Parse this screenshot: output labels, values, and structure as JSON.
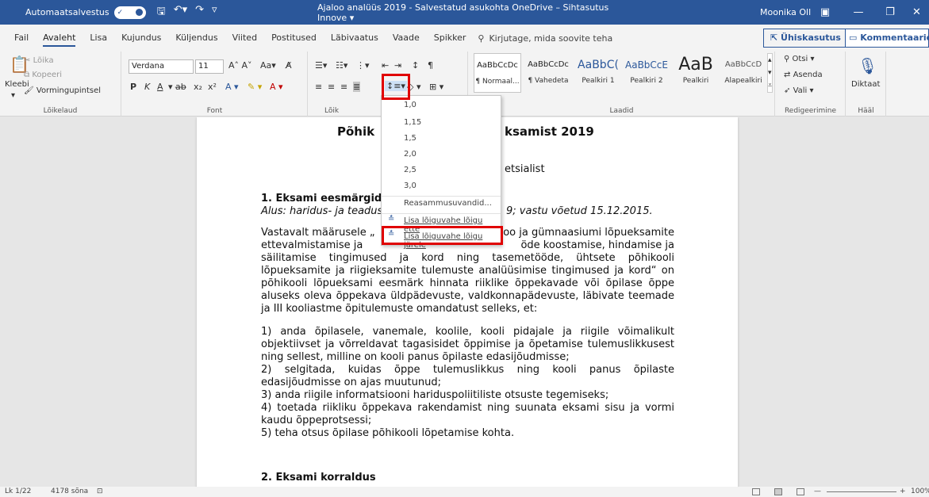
{
  "titlebar": {
    "autosave": "Automaatsalvestus",
    "autosave_state": "✓",
    "title": "Ajaloo analüüs 2019 - Salvestatud asukohta OneDrive – Sihtasutus Innove ▾",
    "user": "Moonika Oll",
    "min": "—",
    "max": "❐",
    "close": "✕"
  },
  "tabs": {
    "items": [
      "Fail",
      "Avaleht",
      "Lisa",
      "Kujundus",
      "Küljendus",
      "Viited",
      "Postitused",
      "Läbivaatus",
      "Vaade",
      "Spikker"
    ],
    "tellme": "Kirjutage, mida soovite teha",
    "share": "Ühiskasutus",
    "comments": "Kommentaarid"
  },
  "ribbon": {
    "clipboard": {
      "paste": "Kleebi",
      "cut": "Lõika",
      "copy": "Kopeeri",
      "painter": "Vormingupintsel",
      "label": "Lõikelaud"
    },
    "font": {
      "name": "Verdana",
      "size": "11",
      "label": "Font",
      "bold": "P",
      "italic": "K",
      "underline": "A"
    },
    "paragraph_label": "Lõik",
    "styles": {
      "label": "Laadid",
      "items": [
        {
          "sample": "AaBbCcDc",
          "name": "¶ Normaal..."
        },
        {
          "sample": "AaBbCcDc",
          "name": "¶ Vahedeta"
        },
        {
          "sample": "AaBbC(",
          "name": "Pealkiri 1"
        },
        {
          "sample": "AaBbCcE",
          "name": "Pealkiri 2"
        },
        {
          "sample": "AaB",
          "name": "Pealkiri"
        },
        {
          "sample": "AaBbCcD",
          "name": "Alapealkiri"
        }
      ]
    },
    "editing": {
      "find": "Otsi",
      "replace": "Asenda",
      "select": "Vali",
      "label": "Redigeerimine"
    },
    "voice": {
      "dictate": "Diktaat",
      "label": "Hääl"
    }
  },
  "dropdown": {
    "options": [
      "1,0",
      "1,15",
      "1,5",
      "2,0",
      "2,5",
      "3,0"
    ],
    "more": "Reasammusuvandid...",
    "add_before": "Lisa lõiguvahe lõigu ette",
    "add_after": "Lisa lõiguvahe lõigu järele"
  },
  "document": {
    "title_left": "Põhik",
    "title_right": "ksamist 2019",
    "subtitle_frag": "etsialist",
    "h1": "1. Eksami eesmärgid",
    "alus_left": "Alus: haridus- ja teadus",
    "alus_right": "9; vastu võetud 15.12.2015.",
    "para1": [
      {
        "l": "Vastavalt määrusele „",
        "r": "oo ja gümnaasiumi lõpueksamite"
      },
      {
        "l": "ettevalmistamise ja",
        "r": "öde koostamise, hindamise ja"
      }
    ],
    "para1_rest": "säilitamise tingimused ja kord ning tasemetööde, ühtsete põhikooli lõpueksamite ja riigieksamite tulemuste analüüsimise tingimused ja kord“ on põhikooli lõpueksami eesmärk hinnata riiklike õppekavade või õpilase õppe aluseks oleva õppekava üldpädevuste, valdkonnapädevuste, läbivate teemade ja III kooliastme õpitulemuste omandatust selleks, et:",
    "list": "1) anda õpilasele, vanemale, koolile, kooli pidajale ja riigile võimalikult objektiivset ja võrreldavat tagasisidet õppimise ja õpetamise tulemuslikkusest ning sellest, milline on kooli panus õpilaste edasijõudmisse;\n2) selgitada, kuidas õppe tulemuslikkus ning kooli panus õpilaste edasijõudmisse on ajas muutunud;\n3) anda riigile informatsiooni hariduspoliitiliste otsuste tegemiseks;\n4) toetada riikliku õppekava rakendamist ning suunata eksami sisu ja vormi kaudu õppeprotsessi;\n5) teha otsus õpilase põhikooli lõpetamise kohta.",
    "h2": "2. Eksami korraldus"
  },
  "status": {
    "page": "Lk 1/22",
    "words": "4178 sõna",
    "zoom": "100%"
  },
  "colors": {
    "accent": "#2b579a",
    "highlight": "#e00000"
  }
}
